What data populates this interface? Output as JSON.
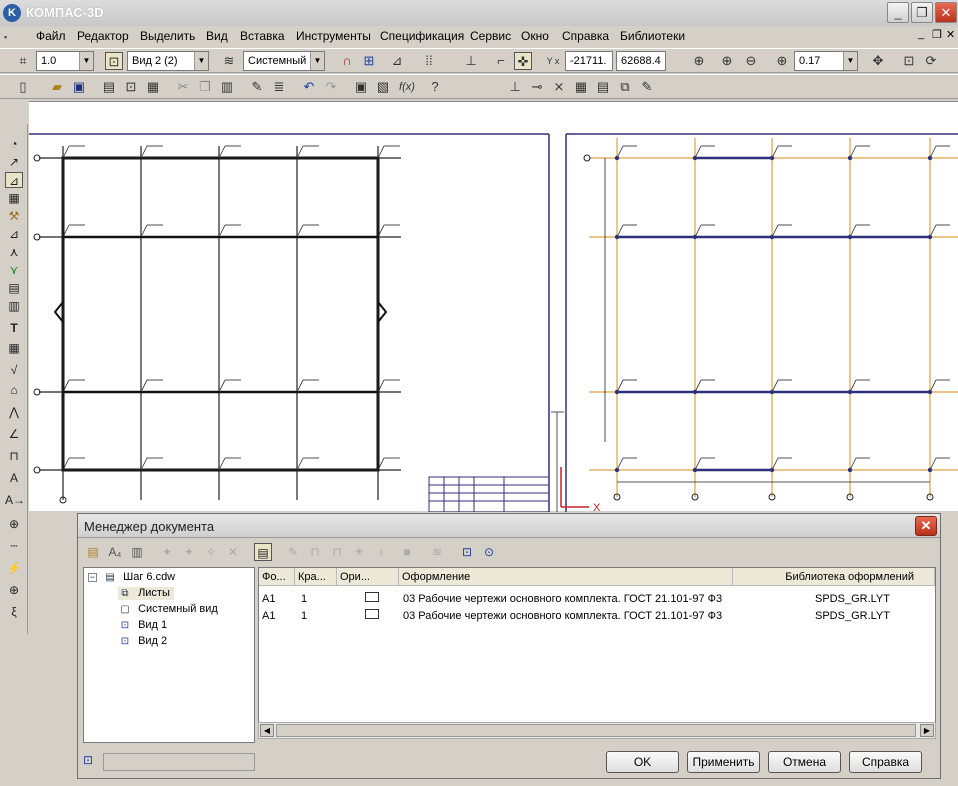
{
  "app": {
    "title": "КОМПАС-3D",
    "logo": "K"
  },
  "window_buttons": {
    "minimize": "_",
    "restore": "❐",
    "close": "✕"
  },
  "menu": [
    "Файл",
    "Редактор",
    "Выделить",
    "Вид",
    "Вставка",
    "Инструменты",
    "Спецификация",
    "Сервис",
    "Окно",
    "Справка",
    "Библиотеки"
  ],
  "toolbar1": {
    "scale_value": "1.0",
    "view_value": "Вид 2 (2)",
    "layer_value": "Системный",
    "coord_x": "-21711.",
    "coord_y": "62688.4",
    "zoom_value": "0.17"
  },
  "dialog": {
    "title": "Менеджер документа",
    "tree": {
      "root": "Шаг 6.cdw",
      "children": [
        "Листы",
        "Системный вид",
        "Вид 1",
        "Вид 2"
      ]
    },
    "columns": [
      "Фо...",
      "Кра...",
      "Ори...",
      "Оформление",
      "Библиотека оформлений"
    ],
    "rows": [
      {
        "format": "A1",
        "multiplicity": "1",
        "design": "03 Рабочие чертежи основного комплекта. ГОСТ 21.101-97 Ф3",
        "library": "SPDS_GR.LYT"
      },
      {
        "format": "A1",
        "multiplicity": "1",
        "design": "03 Рабочие чертежи основного комплекта. ГОСТ 21.101-97 Ф3",
        "library": "SPDS_GR.LYT"
      }
    ],
    "buttons": {
      "ok": "OK",
      "apply": "Применить",
      "cancel": "Отмена",
      "help": "Справка"
    }
  },
  "colors": {
    "accent": "#2a5fa8",
    "grid_orange": "#e0a040",
    "beam_blue": "#30307a",
    "close_red": "#c8402a"
  }
}
